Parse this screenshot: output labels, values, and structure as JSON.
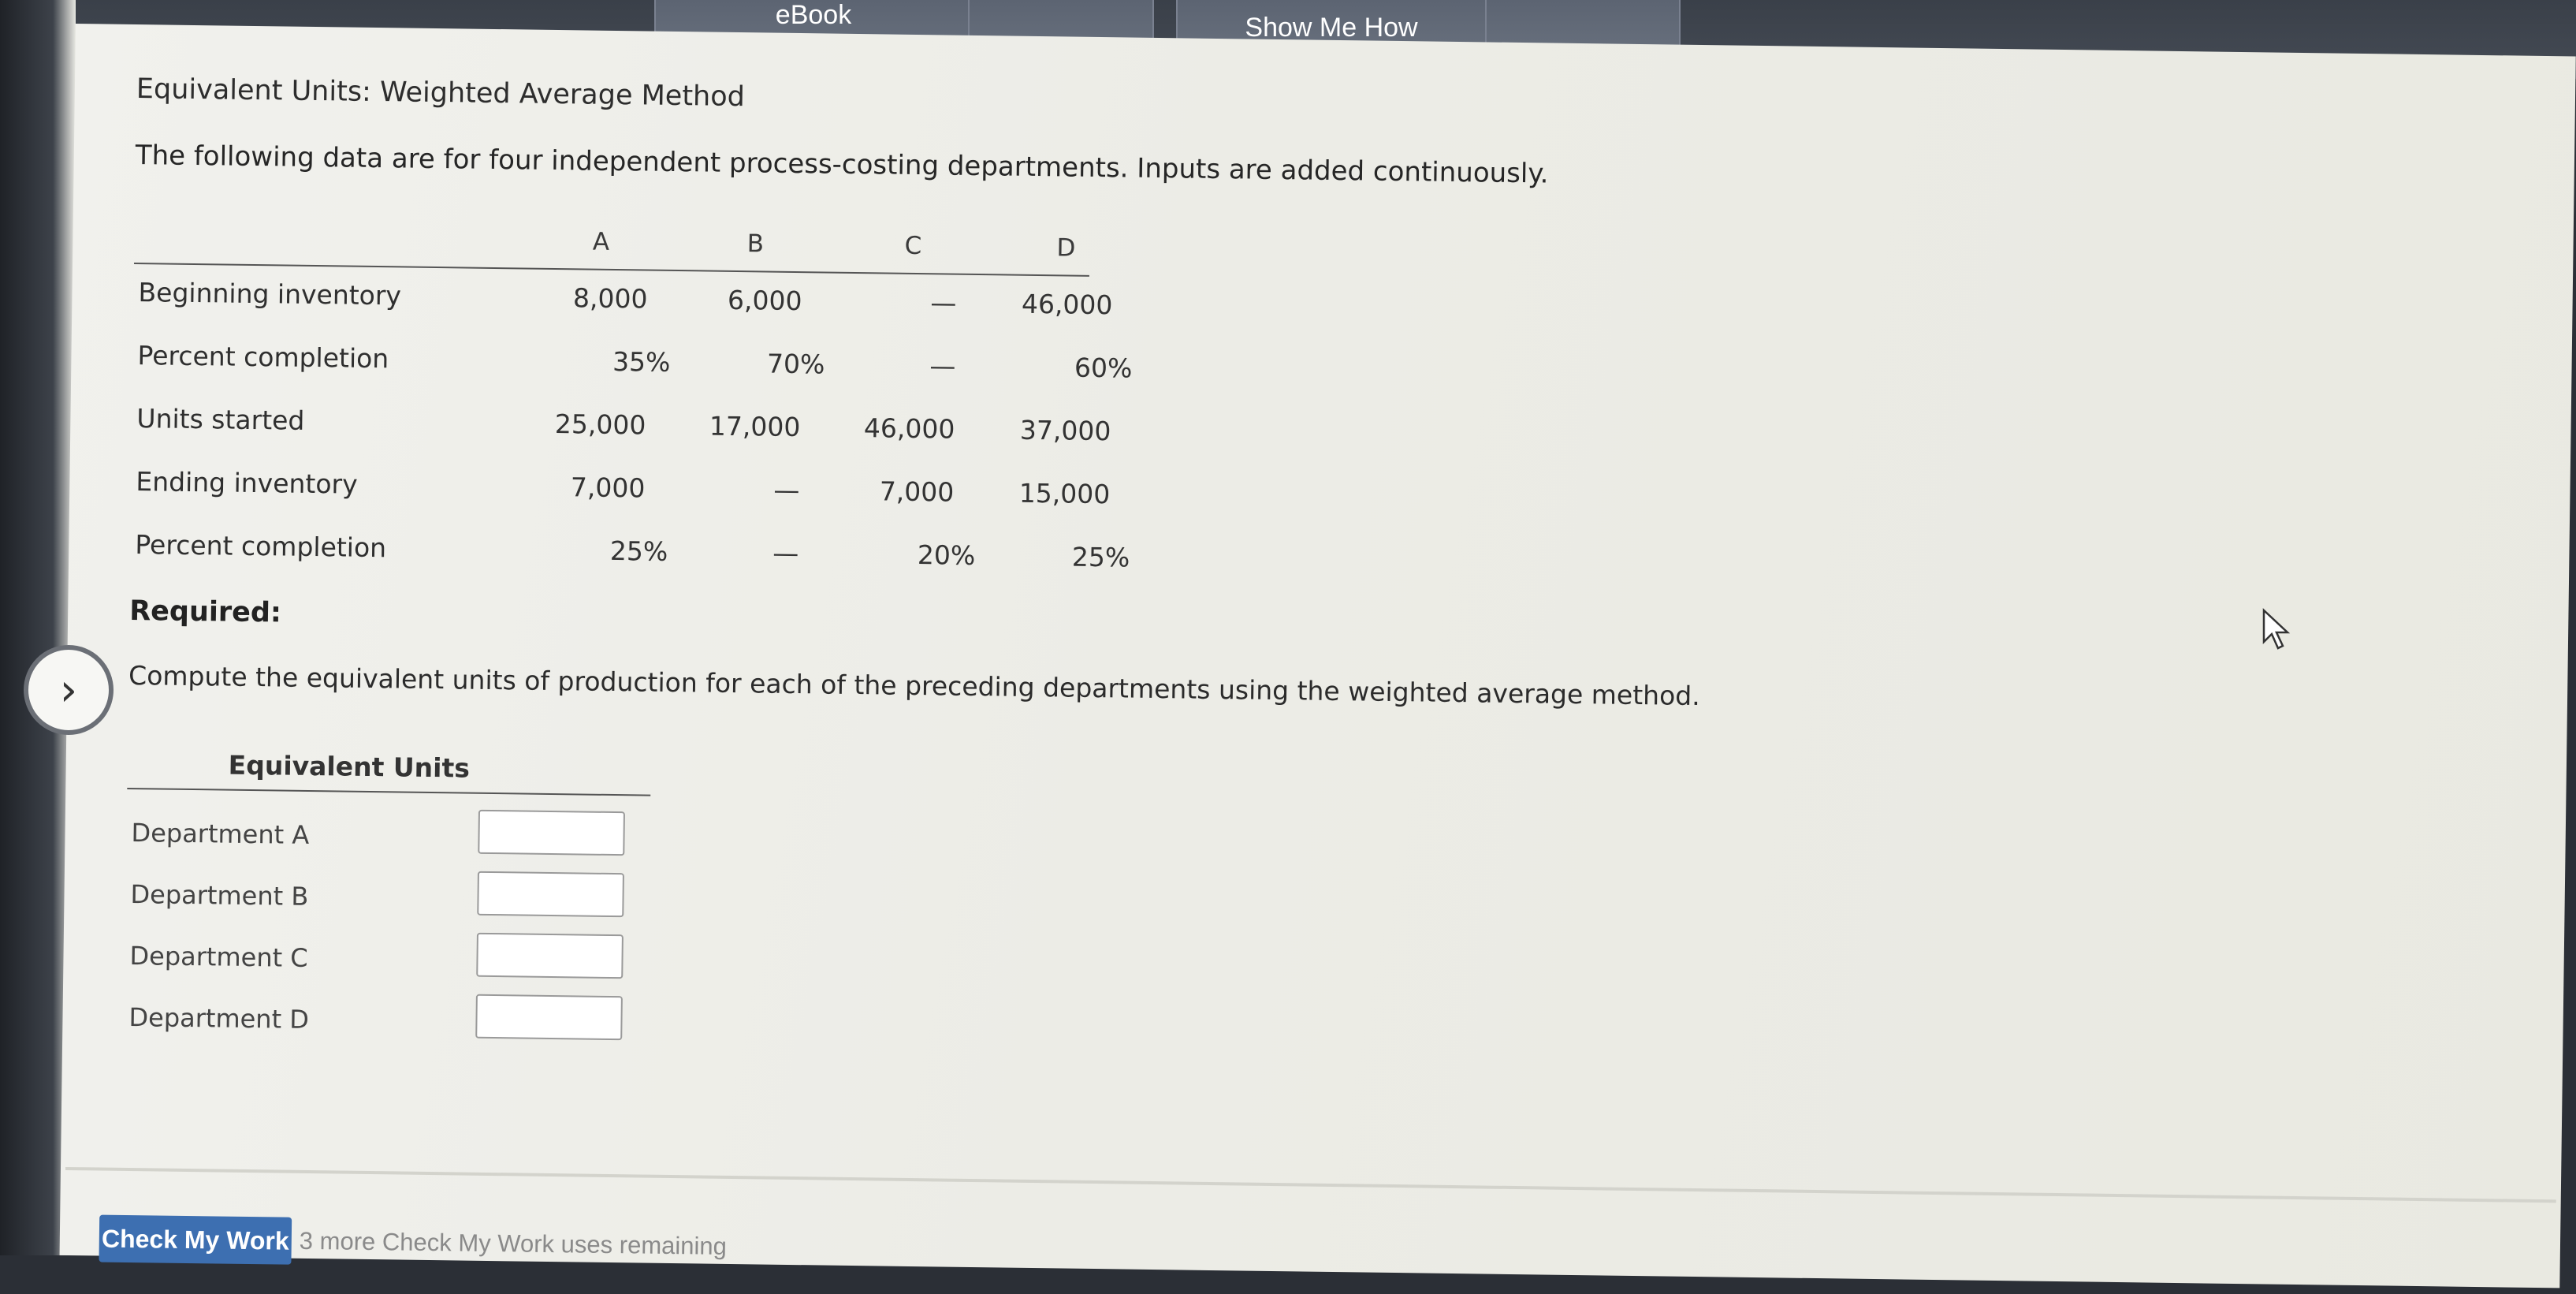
{
  "tabs": {
    "ebook": "eBook",
    "show_me_how": "Show Me How"
  },
  "problem": {
    "title": "Equivalent Units: Weighted Average Method",
    "intro": "The following data are for four independent process-costing departments. Inputs are added continuously.",
    "columns": [
      "A",
      "B",
      "C",
      "D"
    ],
    "rows": [
      {
        "label": "Beginning inventory",
        "values": [
          "8,000",
          "6,000",
          "—",
          "46,000"
        ]
      },
      {
        "label": "Percent completion",
        "values": [
          "35%",
          "70%",
          "—",
          "60%"
        ]
      },
      {
        "label": "Units started",
        "values": [
          "25,000",
          "17,000",
          "46,000",
          "37,000"
        ]
      },
      {
        "label": "Ending inventory",
        "values": [
          "7,000",
          "—",
          "7,000",
          "15,000"
        ]
      },
      {
        "label": "Percent completion",
        "values": [
          "25%",
          "—",
          "20%",
          "25%"
        ]
      }
    ],
    "required_label": "Required:",
    "instruction": "Compute the equivalent units of production for each of the preceding departments using the weighted average method.",
    "answer_header": "Equivalent Units",
    "departments": [
      "Department A",
      "Department B",
      "Department C",
      "Department D"
    ]
  },
  "footer": {
    "check_button": "Check My Work",
    "uses_remaining": "3 more Check My Work uses remaining"
  }
}
